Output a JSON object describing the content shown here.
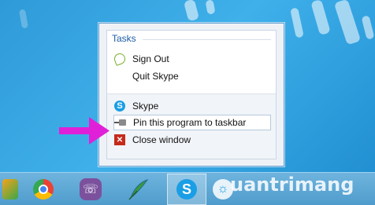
{
  "jumplist": {
    "tasks_title": "Tasks",
    "tasks": [
      {
        "label": "Sign Out",
        "icon": "skype-signout-icon"
      },
      {
        "label": "Quit Skype",
        "icon": ""
      }
    ],
    "footer": [
      {
        "label": "Skype",
        "icon": "skype-icon"
      },
      {
        "label": "Pin this program to taskbar",
        "icon": "pin-icon"
      },
      {
        "label": "Close window",
        "icon": "close-icon"
      }
    ]
  },
  "taskbar": {
    "apps": [
      "app-icon",
      "chrome-icon",
      "viber-icon",
      "feather-icon",
      "skype-icon",
      "bulb-icon"
    ]
  },
  "watermark": "uantrimang",
  "colors": {
    "accent": "#1d5da6",
    "arrow": "#e020d8",
    "skype": "#1a9ee5"
  }
}
